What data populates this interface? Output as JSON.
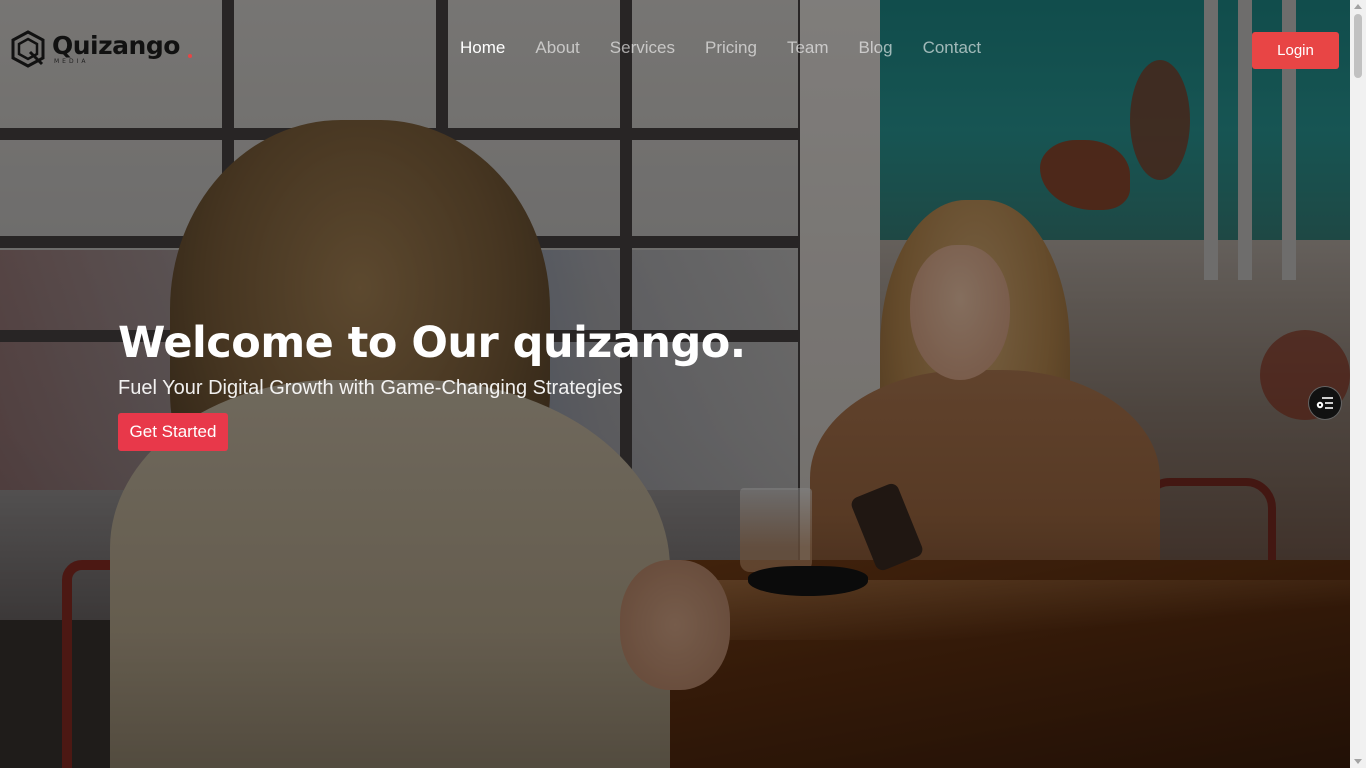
{
  "brand": {
    "name": "Quizango",
    "tagline": "MEDIA",
    "logo_icon": "hexagon-q-logo-icon"
  },
  "nav": {
    "items": [
      {
        "label": "Home",
        "active": true
      },
      {
        "label": "About",
        "active": false
      },
      {
        "label": "Services",
        "active": false
      },
      {
        "label": "Pricing",
        "active": false
      },
      {
        "label": "Team",
        "active": false
      },
      {
        "label": "Blog",
        "active": false
      },
      {
        "label": "Contact",
        "active": false
      }
    ],
    "login_label": "Login"
  },
  "hero": {
    "title": "Welcome to Our quizango.",
    "subtitle": "Fuel Your Digital Growth with Game-Changing Strategies",
    "cta_label": "Get Started",
    "background": "photo of two women sitting at a wooden cafe table"
  },
  "widget": {
    "icon": "settings-list-icon"
  },
  "colors": {
    "accent": "#e84545",
    "cta": "#e8384a",
    "nav_active": "#ffffff",
    "nav_inactive": "rgba(255,255,255,0.6)"
  }
}
